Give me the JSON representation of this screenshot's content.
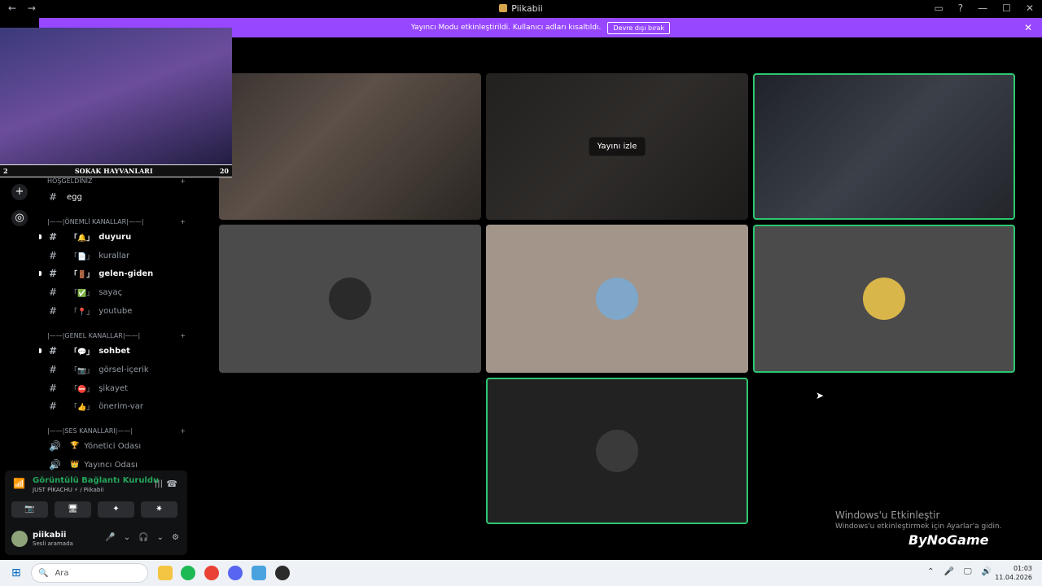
{
  "window": {
    "title": "Piikabii",
    "nav_back": "←",
    "nav_forward": "→",
    "controls": [
      "▭",
      "?",
      "—",
      "☐",
      "✕"
    ]
  },
  "banner": {
    "text": "Yayıncı Modu etkinleştirildi. Kullanıcı adları kısaltıldı.",
    "button": "Devre dışı bırak",
    "close": "✕"
  },
  "rail": {
    "add": "+",
    "explore": "◎"
  },
  "overlay": {
    "bar_left": "2",
    "bar_title": "SOKAK HAYVANLARI",
    "bar_right": "20"
  },
  "sidebar": {
    "welcome_category": "HOŞGELDİNİZ",
    "welcome_channel": "egg",
    "cat_important": "|——|ÖNEMLİ KANALLAR|——|",
    "important_channels": [
      {
        "emoji": "「🔔」",
        "name": "duyuru",
        "unread": true
      },
      {
        "emoji": "「📄」",
        "name": "kurallar",
        "unread": false
      },
      {
        "emoji": "「🚪」",
        "name": "gelen-giden",
        "unread": true
      },
      {
        "emoji": "「✅」",
        "name": "sayaç",
        "unread": false
      },
      {
        "emoji": "「📍」",
        "name": "youtube",
        "unread": false
      }
    ],
    "cat_general": "|——|GENEL KANALLAR|——|",
    "general_channels": [
      {
        "emoji": "「💬」",
        "name": "sohbet",
        "unread": true
      },
      {
        "emoji": "「📷」",
        "name": "görsel-içerik",
        "unread": false
      },
      {
        "emoji": "「⛔」",
        "name": "şikayet",
        "unread": false
      },
      {
        "emoji": "「👍」",
        "name": "önerim-var",
        "unread": false
      }
    ],
    "cat_voice": "|——|SES KANALLARI|——|",
    "voice_channels": [
      {
        "emoji": "🏆",
        "name": "Yönetici Odası"
      },
      {
        "emoji": "👑",
        "name": "Yayıncı Odası"
      }
    ]
  },
  "voice_panel": {
    "status": "Görüntülü Bağlantı Kuruldu",
    "subtitle": "JUST PİKACHU ⚡ / Piikabii",
    "buttons": [
      "📷",
      "🖥",
      "✦",
      "✷"
    ],
    "username": "piikabii",
    "user_status": "Sesli aramada",
    "controls": [
      "🎤",
      "⌄",
      "🎧",
      "⌄",
      "⚙"
    ]
  },
  "stage": {
    "watch_label": "Yayını izle"
  },
  "activation": {
    "title": "Windows'u Etkinleştir",
    "subtitle": "Windows'u etkinleştirmek için Ayarlar'a gidin."
  },
  "watermark": "ByNoGame",
  "taskbar": {
    "search_placeholder": "Ara",
    "time": "01:03",
    "date": "11.04.2026",
    "tray": [
      "⌃",
      "🎤",
      "🖵",
      "🔊"
    ]
  },
  "colors": {
    "accent": "#9747ff",
    "speaking": "#2dc770",
    "background": "#000000"
  }
}
